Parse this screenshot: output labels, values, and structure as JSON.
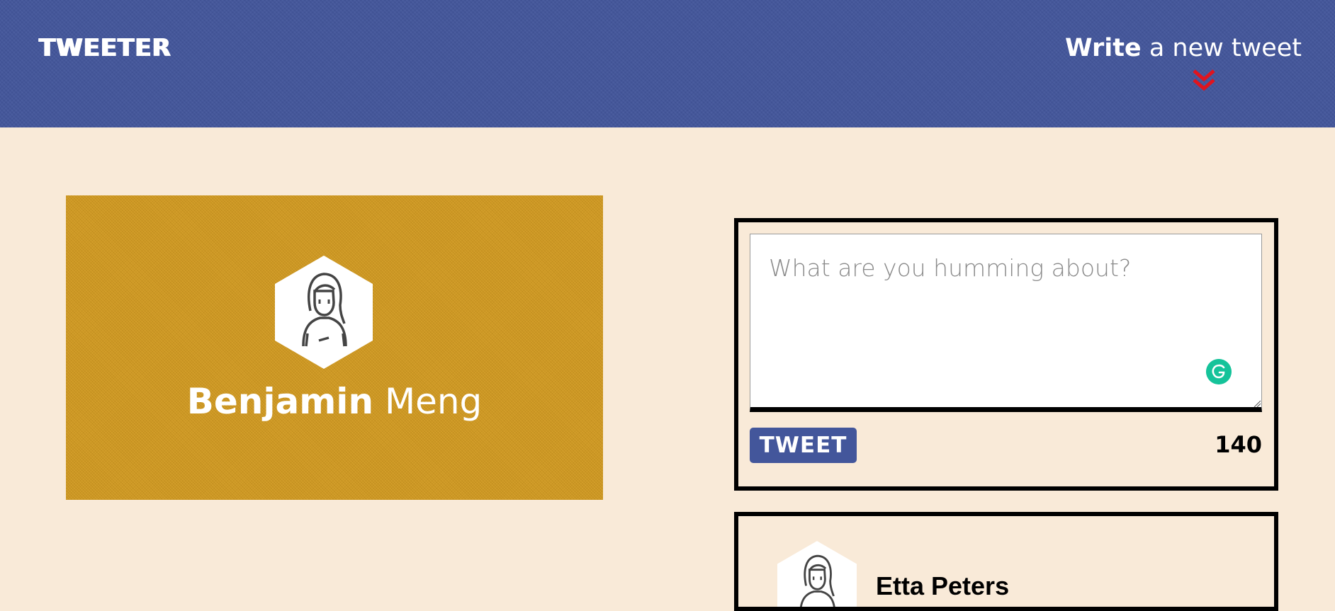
{
  "header": {
    "logo": "TWEETER",
    "compose_toggle": {
      "strong": "Write",
      "light": "a new tweet"
    },
    "chevron_color": "#e0141e",
    "background_color": "#43569b"
  },
  "profile": {
    "first_name": "Benjamin",
    "last_name": "Meng",
    "card_color": "#d1991f",
    "avatar_icon": "person-avatar-icon"
  },
  "composer": {
    "placeholder": "What are you humming about?",
    "value": "",
    "submit_label": "TWEET",
    "char_remaining": "140",
    "button_color": "#43569b",
    "grammarly_color": "#15c39a"
  },
  "tweets": [
    {
      "author": "Etta Peters",
      "avatar_icon": "person-avatar-icon"
    }
  ]
}
